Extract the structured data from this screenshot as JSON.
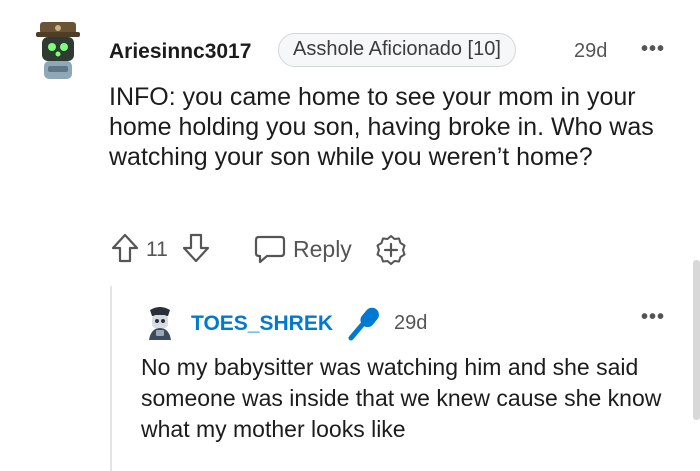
{
  "top_comment": {
    "username": "Ariesinnc3017",
    "flair": "Asshole Aficionado [10]",
    "age": "29d",
    "more_label": "•••",
    "body": "INFO: you came home to see your mom in your home holding you son, having broke in. Who was watching your son while you weren’t home?",
    "score": "11",
    "reply_label": "Reply",
    "icons": {
      "upvote": "arrow-up-outline",
      "downvote": "arrow-down-outline",
      "reply": "speech-bubble",
      "award": "plus-badge"
    }
  },
  "reply_comment": {
    "username": "TOES_SHREK",
    "age": "29d",
    "more_label": "•••",
    "body": "No my babysitter was watching him and she said someone was inside that we knew cause she know what my mother looks like",
    "icons": {
      "badge": "microphone"
    }
  },
  "colors": {
    "username_link": "#0079d3",
    "meta_text": "#555555",
    "flair_bg": "#f6f7f8",
    "thread_line": "#e4e4e4"
  }
}
